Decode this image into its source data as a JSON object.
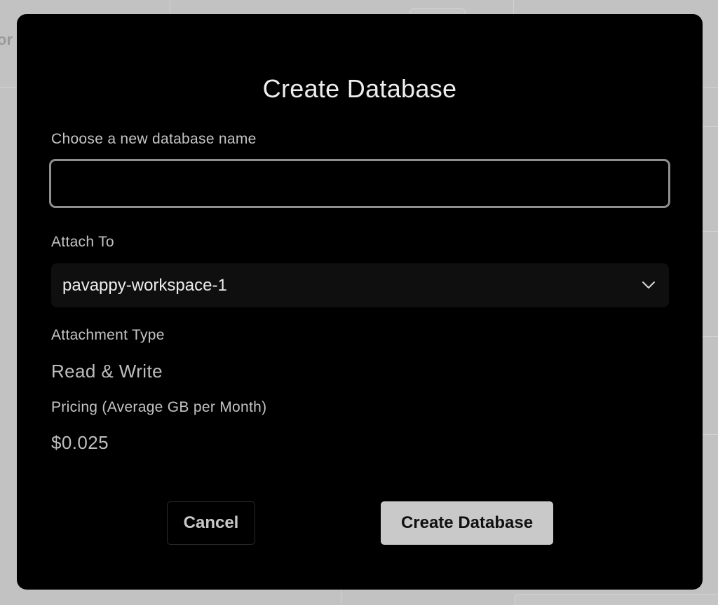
{
  "background": {
    "partial_text": "or"
  },
  "modal": {
    "title": "Create Database",
    "name_field": {
      "label": "Choose a new database name",
      "value": "",
      "placeholder": ""
    },
    "attach_to": {
      "label": "Attach To",
      "selected": "pavappy-workspace-1"
    },
    "attachment_type": {
      "label": "Attachment Type",
      "value": "Read & Write"
    },
    "pricing": {
      "label": "Pricing (Average GB per Month)",
      "value": "$0.025"
    },
    "buttons": {
      "cancel": "Cancel",
      "create": "Create Database"
    }
  },
  "colors": {
    "overlay": "#c2c2c2",
    "modal_background": "#000000",
    "primary_button": "#c9c9c9",
    "input_border": "#8f8f8f"
  },
  "icons": {
    "select_chevron": "chevron-down-icon"
  }
}
